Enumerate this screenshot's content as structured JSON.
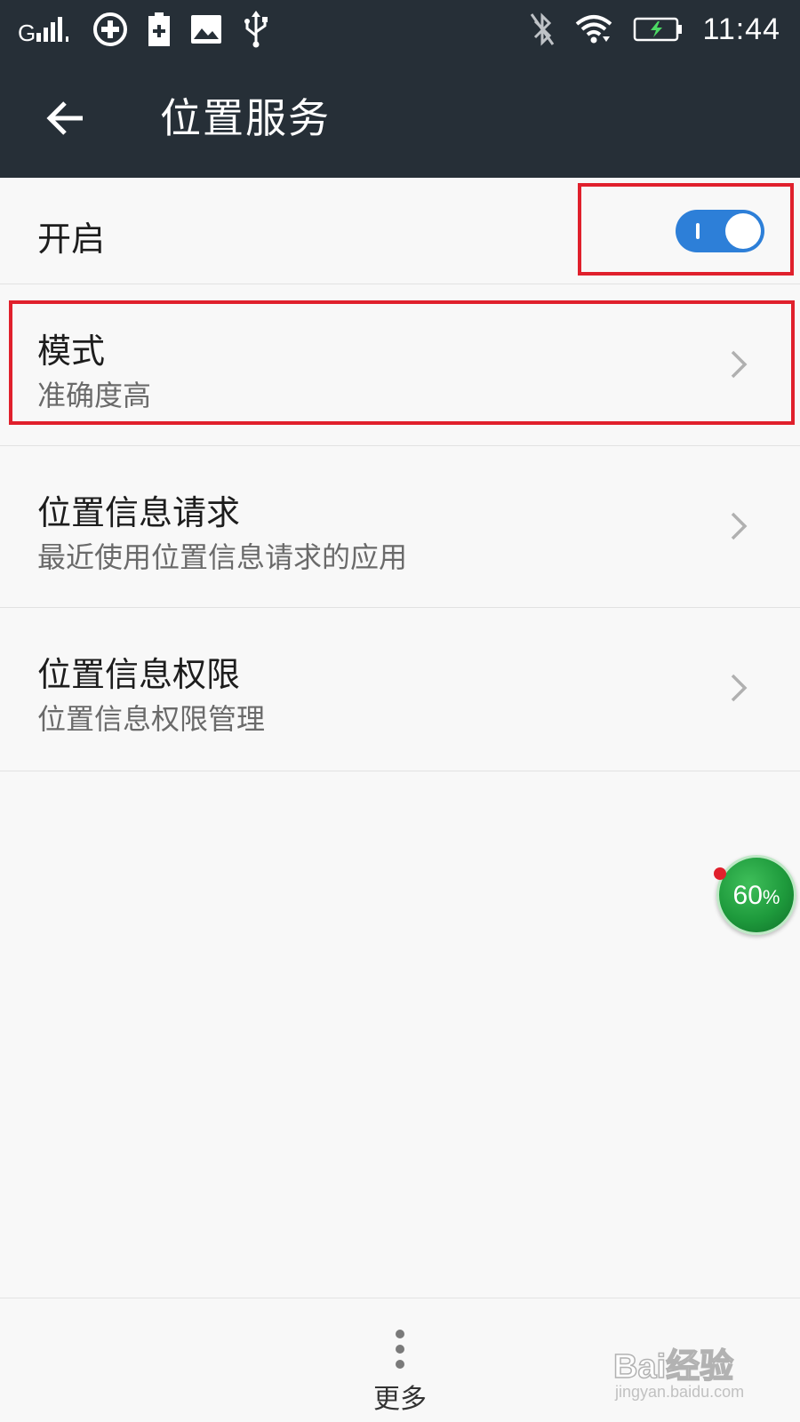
{
  "status_bar": {
    "time": "11:44",
    "left_icons": [
      "signal-icon",
      "data-saver-icon",
      "battery-plus-icon",
      "image-icon",
      "usb-icon"
    ],
    "right_icons": [
      "bluetooth-icon",
      "wifi-icon",
      "battery-charging-icon"
    ]
  },
  "app_bar": {
    "back_icon": "back-arrow-icon",
    "title": "位置服务"
  },
  "settings": {
    "switch": {
      "label": "开启",
      "on": true,
      "accent": "#2d7fd8"
    },
    "items": [
      {
        "title": "模式",
        "subtitle": "准确度高"
      },
      {
        "title": "位置信息请求",
        "subtitle": "最近使用位置信息请求的应用"
      },
      {
        "title": "位置信息权限",
        "subtitle": "位置信息权限管理"
      }
    ]
  },
  "floating_widget": {
    "value": "60",
    "unit": "%"
  },
  "bottom_bar": {
    "more_label": "更多",
    "more_icon": "more-vertical-icon"
  },
  "watermark": {
    "logo": "Bai经验",
    "url": "jingyan.baidu.com"
  },
  "colors": {
    "app_bar": "#262f37",
    "highlight": "#e0202c",
    "background": "#f8f8f8"
  }
}
